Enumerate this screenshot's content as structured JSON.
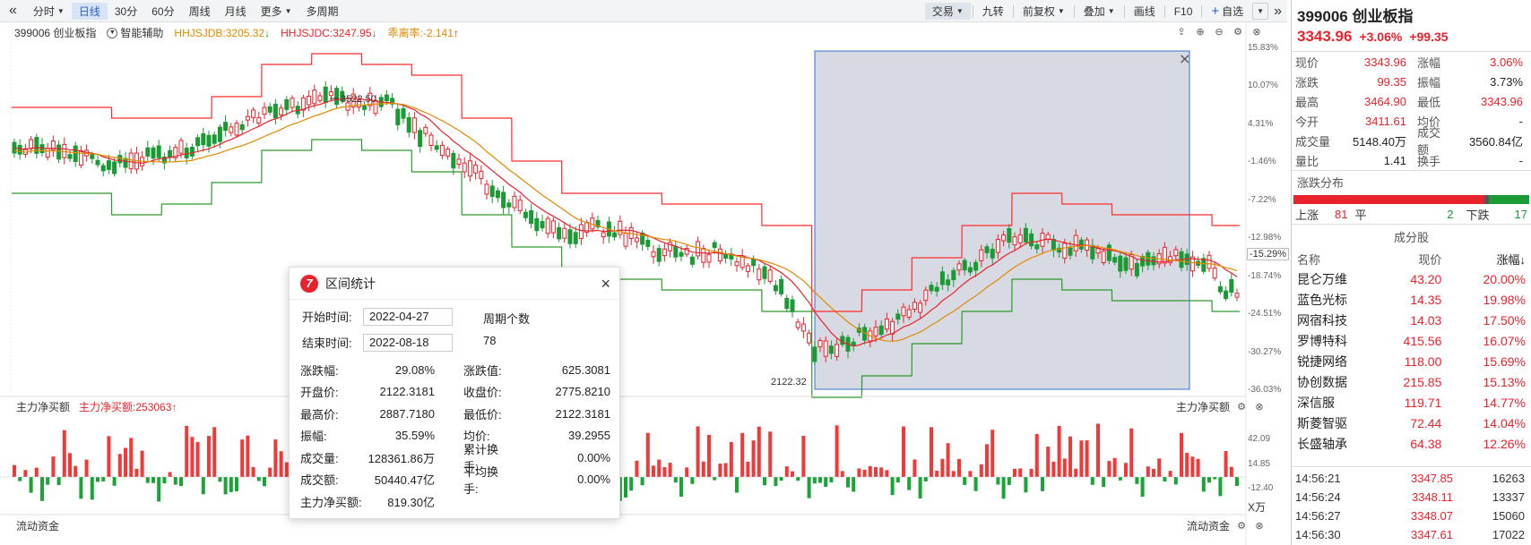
{
  "toolbar": {
    "collapse_label": "«",
    "periods": [
      "分时",
      "日线",
      "30分",
      "60分",
      "周线",
      "月线",
      "更多",
      "多周期"
    ],
    "active_period": "日线",
    "right": [
      "交易",
      "九转",
      "前复权",
      "叠加",
      "画线",
      "F10",
      "自选"
    ],
    "expand_label": "»"
  },
  "legend": {
    "index_name": "399006 创业板指",
    "assist": "智能辅助",
    "items": [
      {
        "text": "HHJSJDB:3205.32",
        "color": "#e08a00",
        "arrow": "↓",
        "arrow_color": "#1a9a35"
      },
      {
        "text": "HHJSJDC:3247.95",
        "color": "#e8232c",
        "arrow": "↓",
        "arrow_color": "#1a9a35"
      },
      {
        "text": "乖离率:-2.141",
        "color": "#e08a00",
        "arrow": "↑",
        "arrow_color": "#e8232c"
      }
    ]
  },
  "chart_data": {
    "type": "candlestick",
    "high_label": "3522.50",
    "low_label": "2122.32",
    "right_axis_pct": [
      "15.83%",
      "10.07%",
      "4.31%",
      "-1.46%",
      "-7.22%",
      "-12.98%",
      "-18.74%",
      "-24.51%",
      "-30.27%",
      "-36.03%"
    ],
    "current_pct": "-15.29%",
    "volume_axis": [
      "42.09",
      "14.85",
      "-12.40"
    ],
    "volume_unit": "X万"
  },
  "sub_panel": {
    "title": "主力净买额",
    "value_label": "主力净买额:253063",
    "value_arrow": "↑",
    "right_title": "主力净买额",
    "bottom_title": "流动资金",
    "bottom_right_title": "流动资金"
  },
  "dialog": {
    "title": "区间统计",
    "close": "×",
    "start_label": "开始时间:",
    "start_value": "2022-04-27",
    "end_label": "结束时间:",
    "end_value": "2022-08-18",
    "period_count_label": "周期个数",
    "period_count": "78",
    "stats": [
      {
        "k1": "涨跌幅:",
        "v1": "29.08%",
        "k2": "涨跌值:",
        "v2": "625.3081"
      },
      {
        "k1": "开盘价:",
        "v1": "2122.3181",
        "k2": "收盘价:",
        "v2": "2775.8210"
      },
      {
        "k1": "最高价:",
        "v1": "2887.7180",
        "k2": "最低价:",
        "v2": "2122.3181"
      },
      {
        "k1": "振幅:",
        "v1": "35.59%",
        "k2": "均价:",
        "v2": "39.2955"
      },
      {
        "k1": "成交量:",
        "v1": "128361.86万",
        "k2": "累计换手:",
        "v2": "0.00%"
      },
      {
        "k1": "成交额:",
        "v1": "50440.47亿",
        "k2": "平均换手:",
        "v2": "0.00%"
      },
      {
        "k1": "主力净买额:",
        "v1": "819.30亿",
        "k2": "",
        "v2": ""
      }
    ]
  },
  "quote": {
    "title": "399006 创业板指",
    "price": "3343.96",
    "change_pct": "+3.06%",
    "change_val": "+99.35",
    "rows": [
      {
        "l1": "现价",
        "v1": "3343.96",
        "c1": "red",
        "l2": "涨幅",
        "v2": "3.06%",
        "c2": "red"
      },
      {
        "l1": "涨跌",
        "v1": "99.35",
        "c1": "red",
        "l2": "振幅",
        "v2": "3.73%",
        "c2": "dark"
      },
      {
        "l1": "最高",
        "v1": "3464.90",
        "c1": "red",
        "l2": "最低",
        "v2": "3343.96",
        "c2": "red"
      },
      {
        "l1": "今开",
        "v1": "3411.61",
        "c1": "red",
        "l2": "均价",
        "v2": "-",
        "c2": "dark"
      },
      {
        "l1": "成交量",
        "v1": "5148.40万",
        "c1": "dark",
        "l2": "成交额",
        "v2": "3560.84亿",
        "c2": "dark"
      },
      {
        "l1": "量比",
        "v1": "1.41",
        "c1": "dark",
        "l2": "换手",
        "v2": "-",
        "c2": "dark"
      }
    ],
    "dist_title": "涨跌分布",
    "up_label": "上涨",
    "up_count": "81",
    "flat_label": "平",
    "flat_count": "2",
    "down_label": "下跌",
    "down_count": "17",
    "components_title": "成分股",
    "col_name": "名称",
    "col_price": "现价",
    "col_change": "涨幅↓",
    "stocks": [
      {
        "name": "昆仑万维",
        "price": "43.20",
        "change": "20.00%"
      },
      {
        "name": "蓝色光标",
        "price": "14.35",
        "change": "19.98%"
      },
      {
        "name": "网宿科技",
        "price": "14.03",
        "change": "17.50%"
      },
      {
        "name": "罗博特科",
        "price": "415.56",
        "change": "16.07%"
      },
      {
        "name": "锐捷网络",
        "price": "118.00",
        "change": "15.69%"
      },
      {
        "name": "协创数据",
        "price": "215.85",
        "change": "15.13%"
      },
      {
        "name": "深信服",
        "price": "119.71",
        "change": "14.77%"
      },
      {
        "name": "斯菱智驱",
        "price": "72.44",
        "change": "14.04%"
      },
      {
        "name": "长盛轴承",
        "price": "64.38",
        "change": "12.26%"
      }
    ],
    "ticks": [
      {
        "time": "14:56:21",
        "price": "3347.85",
        "vol": "16263"
      },
      {
        "time": "14:56:24",
        "price": "3348.11",
        "vol": "13337"
      },
      {
        "time": "14:56:27",
        "price": "3348.07",
        "vol": "15060"
      },
      {
        "time": "14:56:30",
        "price": "3347.61",
        "vol": "17022"
      }
    ]
  }
}
